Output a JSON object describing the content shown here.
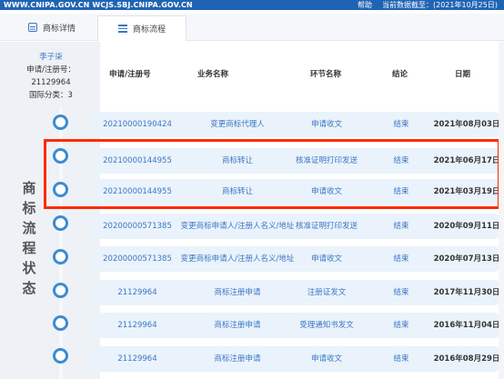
{
  "topbar": {
    "site": "WWW.CNIPA.GOV.CN WCJS.SBJ.CNIPA.GOV.CN",
    "help": "帮助",
    "data_date": "当前数据截至：(2021年10月25日)"
  },
  "tabs": [
    {
      "label": "商标详情",
      "icon": "document-icon"
    },
    {
      "label": "商标流程",
      "icon": "list-icon"
    }
  ],
  "person": {
    "name": "李子柒",
    "reg_no": "申请/注册号：21129964",
    "class": "国际分类：3"
  },
  "section_title": [
    "商",
    "标",
    "流",
    "程",
    "状",
    "态"
  ],
  "table": {
    "headers": [
      "申请/注册号",
      "业务名称",
      "环节名称",
      "结论",
      "日期"
    ],
    "rows": [
      {
        "no": "20210000190424",
        "biz": "变更商标代理人",
        "step": "申请收文",
        "result": "结束",
        "date": "2021年08月03日"
      },
      {
        "no": "20210000144955",
        "biz": "商标转让",
        "step": "核准证明打印发送",
        "result": "结束",
        "date": "2021年06月17日"
      },
      {
        "no": "20210000144955",
        "biz": "商标转让",
        "step": "申请收文",
        "result": "结束",
        "date": "2021年03月19日"
      },
      {
        "no": "20200000571385",
        "biz": "变更商标申请人/注册人名义/地址",
        "step": "核准证明打印发送",
        "result": "结束",
        "date": "2020年09月11日"
      },
      {
        "no": "20200000571385",
        "biz": "变更商标申请人/注册人名义/地址",
        "step": "申请收文",
        "result": "结束",
        "date": "2020年07月13日"
      },
      {
        "no": "21129964",
        "biz": "商标注册申请",
        "step": "注册证发文",
        "result": "结束",
        "date": "2017年11月30日"
      },
      {
        "no": "21129964",
        "biz": "商标注册申请",
        "step": "受理通知书发文",
        "result": "结束",
        "date": "2016年11月04日"
      },
      {
        "no": "21129964",
        "biz": "商标注册申请",
        "step": "申请收文",
        "result": "结束",
        "date": "2016年08月29日"
      }
    ]
  },
  "colors": {
    "accent": "#3b76c5",
    "row_bg": "#eaf3fb",
    "highlight": "#ff2a00",
    "topbar": "#1f64b4"
  }
}
